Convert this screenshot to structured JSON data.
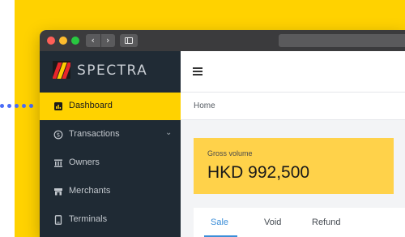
{
  "app": {
    "brand": "SPECTRA"
  },
  "sidebar": {
    "items": [
      {
        "label": "Dashboard",
        "icon": "dashboard-icon",
        "active": true
      },
      {
        "label": "Transactions",
        "icon": "dollar-circle-icon",
        "has_submenu": true
      },
      {
        "label": "Owners",
        "icon": "bank-icon"
      },
      {
        "label": "Merchants",
        "icon": "store-icon"
      },
      {
        "label": "Terminals",
        "icon": "terminal-icon"
      }
    ]
  },
  "breadcrumb": {
    "current": "Home"
  },
  "summary": {
    "caption": "Gross volume",
    "value": "HKD 992,500"
  },
  "tabs": [
    {
      "label": "Sale",
      "active": true
    },
    {
      "label": "Void"
    },
    {
      "label": "Refund"
    }
  ],
  "colors": {
    "accent": "#FFD200",
    "card": "#FFD24A",
    "sidebar": "#1F2A34",
    "active_tab": "#3B8ED8",
    "connector_dots": "#4A6CF7"
  }
}
